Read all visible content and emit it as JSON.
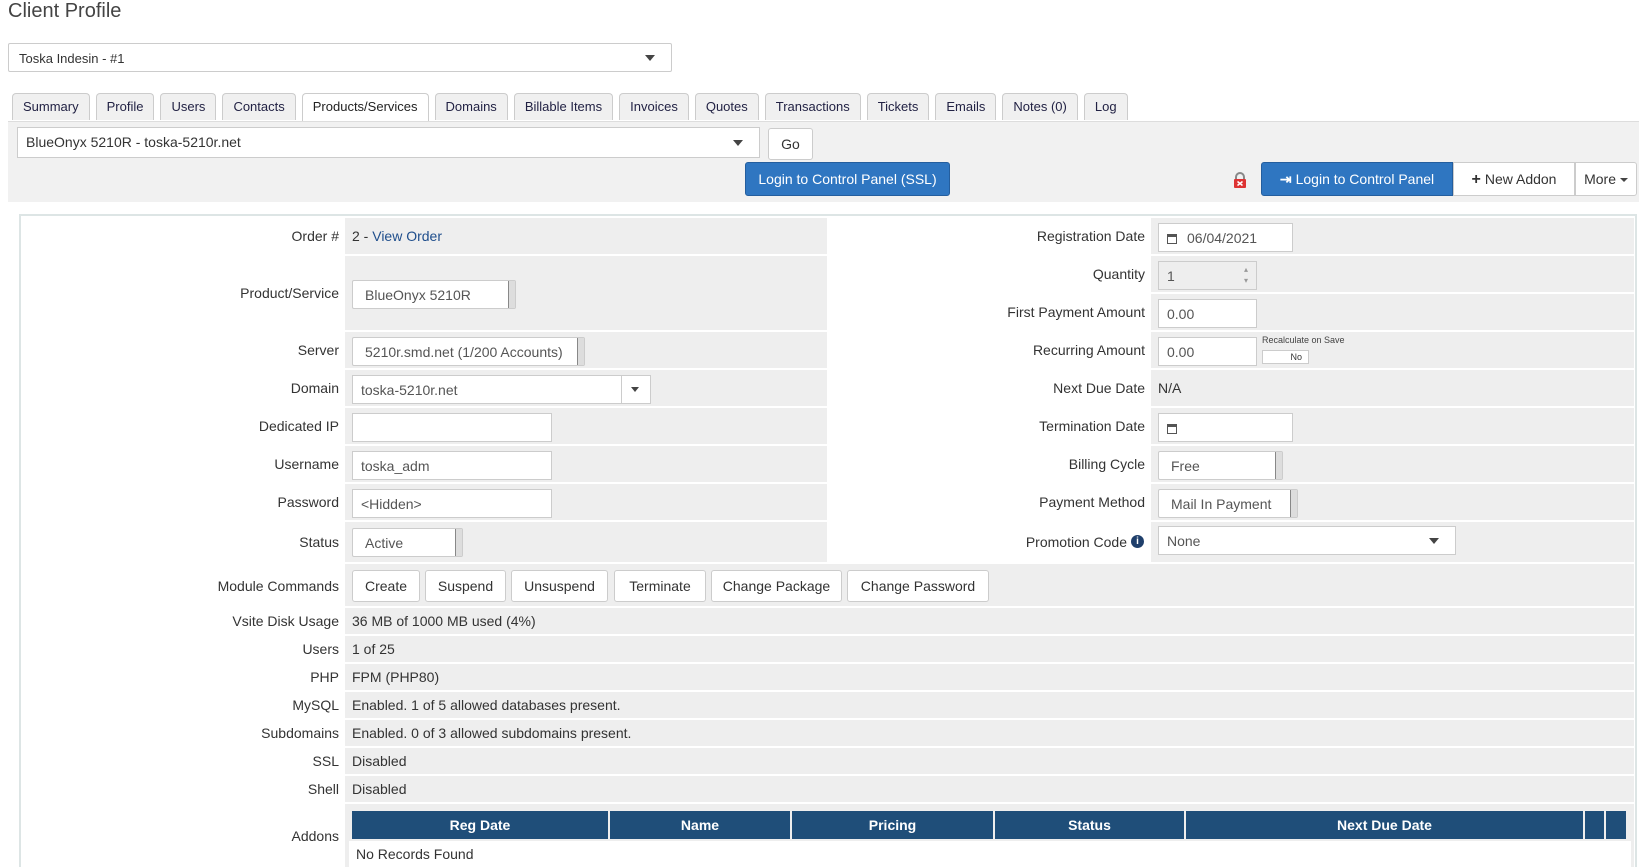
{
  "page": {
    "title": "Client Profile"
  },
  "client_select": {
    "value": "Toska Indesin - #1"
  },
  "tabs": [
    {
      "label": "Summary"
    },
    {
      "label": "Profile"
    },
    {
      "label": "Users"
    },
    {
      "label": "Contacts"
    },
    {
      "label": "Products/Services"
    },
    {
      "label": "Domains"
    },
    {
      "label": "Billable Items"
    },
    {
      "label": "Invoices"
    },
    {
      "label": "Quotes"
    },
    {
      "label": "Transactions"
    },
    {
      "label": "Tickets"
    },
    {
      "label": "Emails"
    },
    {
      "label": "Notes (0)"
    },
    {
      "label": "Log"
    }
  ],
  "service_bar": {
    "service_select": "BlueOnyx 5210R - toska-5210r.net",
    "go_label": "Go",
    "login_ssl_label": "Login to Control Panel (SSL)",
    "login_label": "Login to Control Panel",
    "new_addon_label": "New Addon",
    "more_label": "More"
  },
  "form_left": {
    "order_label": "Order #",
    "order_number": "2 - ",
    "order_link": "View Order",
    "product_label": "Product/Service",
    "product_value": "BlueOnyx 5210R",
    "server_label": "Server",
    "server_value": "5210r.smd.net (1/200 Accounts)",
    "domain_label": "Domain",
    "domain_value": "toska-5210r.net",
    "dedicated_ip_label": "Dedicated IP",
    "dedicated_ip_value": "",
    "username_label": "Username",
    "username_value": "toska_adm",
    "password_label": "Password",
    "password_value": "<Hidden>",
    "status_label": "Status",
    "status_value": "Active"
  },
  "form_right": {
    "reg_date_label": "Registration Date",
    "reg_date_value": "06/04/2021",
    "quantity_label": "Quantity",
    "quantity_value": "1",
    "first_payment_label": "First Payment Amount",
    "first_payment_value": "0.00",
    "recurring_label": "Recurring Amount",
    "recurring_value": "0.00",
    "recalc_label": "Recalculate on Save",
    "recalc_toggle": "No",
    "next_due_label": "Next Due Date",
    "next_due_value": "N/A",
    "termination_label": "Termination Date",
    "termination_value": "",
    "billing_cycle_label": "Billing Cycle",
    "billing_cycle_value": "Free",
    "payment_method_label": "Payment Method",
    "payment_method_value": "Mail In Payment",
    "promo_label": "Promotion Code",
    "promo_value": "None"
  },
  "module": {
    "label": "Module Commands",
    "buttons": [
      {
        "label": "Create"
      },
      {
        "label": "Suspend"
      },
      {
        "label": "Unsuspend"
      },
      {
        "label": "Terminate"
      },
      {
        "label": "Change Package"
      },
      {
        "label": "Change Password"
      }
    ]
  },
  "info_rows": [
    {
      "label": "Vsite Disk Usage",
      "value": "36 MB of 1000 MB used (4%)"
    },
    {
      "label": "Users",
      "value": "1 of 25"
    },
    {
      "label": "PHP",
      "value": "FPM (PHP80)"
    },
    {
      "label": "MySQL",
      "value": "Enabled. 1 of 5 allowed databases present."
    },
    {
      "label": "Subdomains",
      "value": "Enabled. 0 of 3 allowed subdomains present."
    },
    {
      "label": "SSL",
      "value": "Disabled"
    },
    {
      "label": "Shell",
      "value": "Disabled"
    }
  ],
  "addons": {
    "label": "Addons",
    "columns": [
      "Reg Date",
      "Name",
      "Pricing",
      "Status",
      "Next Due Date"
    ],
    "empty_text": "No Records Found"
  },
  "colors": {
    "primary_button": "#2f76c1",
    "table_header": "#1f4e79",
    "link": "#1f4e8c"
  }
}
